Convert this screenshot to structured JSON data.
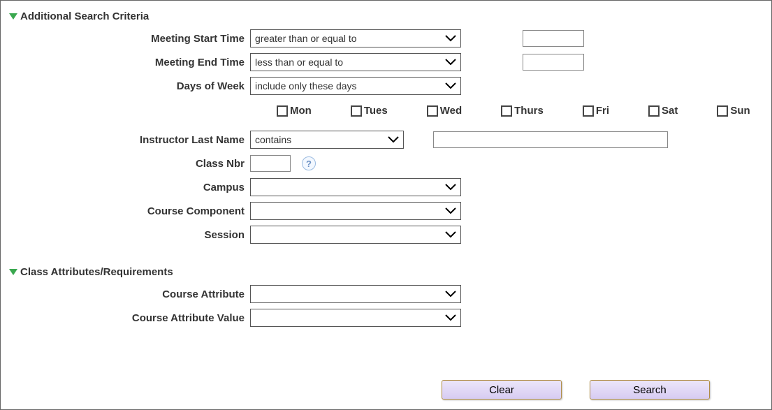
{
  "section1": {
    "title": "Additional Search Criteria",
    "meeting_start": {
      "label": "Meeting Start Time",
      "operator": "greater than or equal to",
      "value": ""
    },
    "meeting_end": {
      "label": "Meeting End Time",
      "operator": "less than or equal to",
      "value": ""
    },
    "days_of_week": {
      "label": "Days of Week",
      "operator": "include only these days",
      "days": [
        "Mon",
        "Tues",
        "Wed",
        "Thurs",
        "Fri",
        "Sat",
        "Sun"
      ]
    },
    "instructor": {
      "label": "Instructor Last Name",
      "operator": "contains",
      "value": ""
    },
    "class_nbr": {
      "label": "Class Nbr",
      "value": ""
    },
    "campus": {
      "label": "Campus",
      "value": ""
    },
    "course_component": {
      "label": "Course Component",
      "value": ""
    },
    "session": {
      "label": "Session",
      "value": ""
    }
  },
  "section2": {
    "title": "Class Attributes/Requirements",
    "course_attribute": {
      "label": "Course Attribute",
      "value": ""
    },
    "course_attribute_value": {
      "label": "Course Attribute Value",
      "value": ""
    }
  },
  "buttons": {
    "clear": "Clear",
    "search": "Search"
  }
}
